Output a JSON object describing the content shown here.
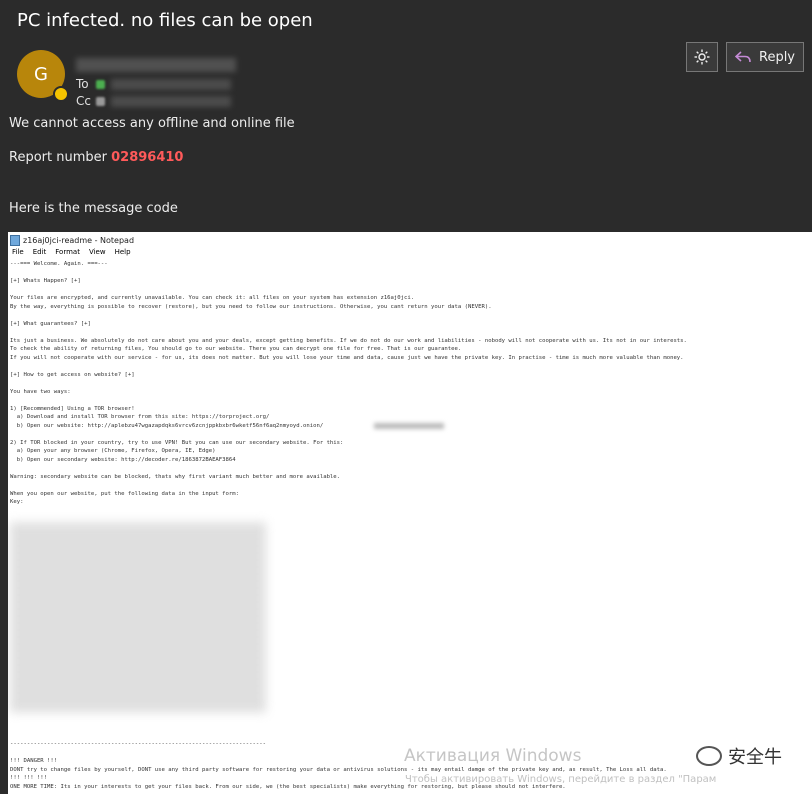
{
  "email": {
    "subject": "PC infected. no files can be open",
    "avatar_initial": "G",
    "to_label": "To",
    "cc_label": "Cc",
    "reply_label": "Reply",
    "body": {
      "line1": "We cannot access any offline and online file",
      "report_label": "Report number",
      "report_number": "02896410",
      "line3": "Here is the message code"
    }
  },
  "notepad": {
    "title": "z16aj0jci-readme - Notepad",
    "menu": [
      "File",
      "Edit",
      "Format",
      "View",
      "Help"
    ],
    "text": "---=== Welcome. Again. ===---\n\n[+] Whats Happen? [+]\n\nYour files are encrypted, and currently unavailable. You can check it: all files on your system has extension z16aj0jci.\nBy the way, everything is possible to recover (restore), but you need to follow our instructions. Otherwise, you cant return your data (NEVER).\n\n[+] What guarantees? [+]\n\nIts just a business. We absolutely do not care about you and your deals, except getting benefits. If we do not do our work and liabilities - nobody will not cooperate with us. Its not in our interests.\nTo check the ability of returning files, You should go to our website. There you can decrypt one file for free. That is our guarantee.\nIf you will not cooperate with our service - for us, its does not matter. But you will lose your time and data, cause just we have the private key. In practise - time is much more valuable than money.\n\n[+] How to get access on website? [+]\n\nYou have two ways:\n\n1) [Recommended] Using a TOR browser!\n  a) Download and install TOR browser from this site: https://torproject.org/\n  b) Open our website: http://aplebzu47wgazapdqks6vrcv6zcnjppkbxbr6wketf56nf6aq2nmyoyd.onion/\n\n2) If TOR blocked in your country, try to use VPN! But you can use our secondary website. For this:\n  a) Open your any browser (Chrome, Firefox, Opera, IE, Edge)\n  b) Open our secondary website: http://decoder.re/1863872BAEAF3864\n\nWarning: secondary website can be blocked, thats why first variant much better and more available.\n\nWhen you open our website, put the following data in the input form:\nKey:",
    "bottom_text": "----------------------------------------------------------------------------\n\n!!! DANGER !!!\nDONT try to change files by yourself, DONT use any third party software for restoring your data or antivirus solutions - its may entail damge of the private key and, as result, The Loss all data.\n!!! !!! !!!\nONE MORE TIME: Its in your interests to get your files back. From our side, we (the best specialists) make everything for restoring, but please should not interfere."
  },
  "overlay": {
    "activation_title": "Активация Windows",
    "activation_sub": "Чтобы активировать Windows, перейдите в раздел \"Парам",
    "brand": "安全牛"
  },
  "colors": {
    "background": "#2b2b2b",
    "report_number": "#ff5a5a",
    "avatar": "#b8860b"
  }
}
